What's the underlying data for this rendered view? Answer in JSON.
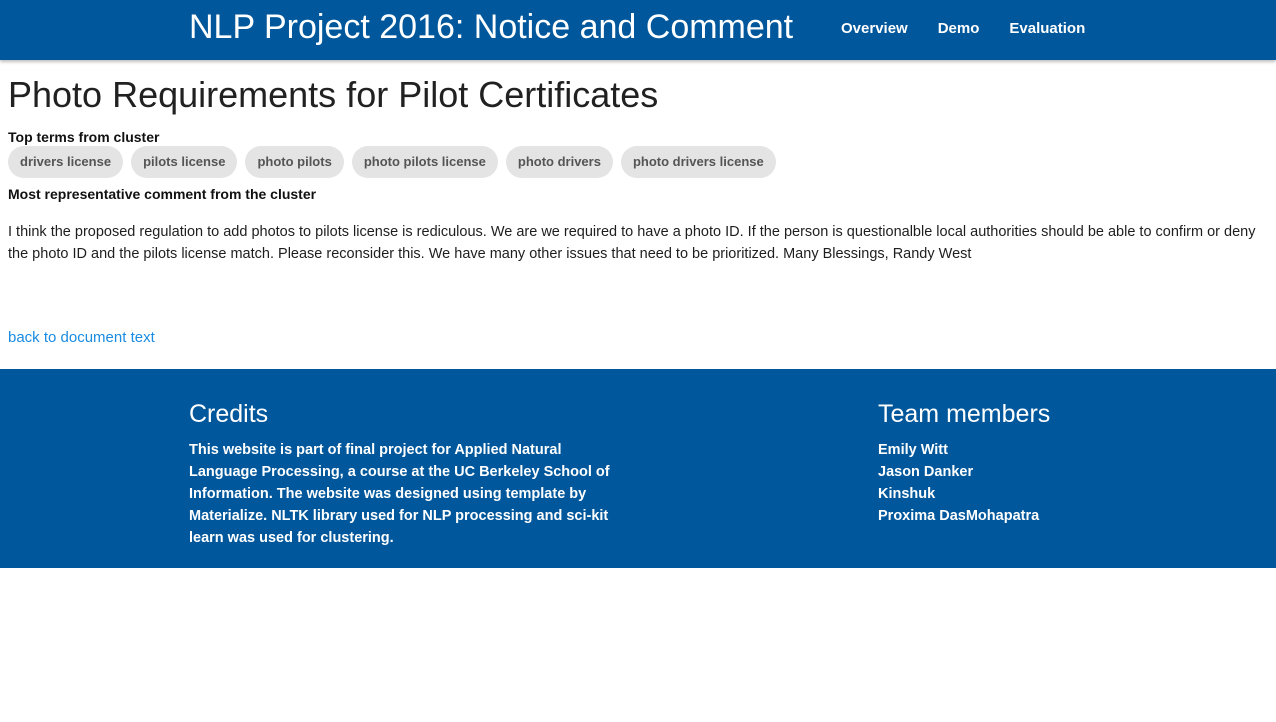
{
  "header": {
    "brand": "NLP Project 2016: Notice and Comment",
    "nav": [
      {
        "label": "Overview"
      },
      {
        "label": "Demo"
      },
      {
        "label": "Evaluation"
      }
    ]
  },
  "main": {
    "title": "Photo Requirements for Pilot Certificates",
    "top_terms_label": "Top terms from cluster",
    "terms": [
      "drivers license",
      "pilots license",
      "photo pilots",
      "photo pilots license",
      "photo drivers",
      "photo drivers license"
    ],
    "representative_label": "Most representative comment from the cluster",
    "comment": "I think the proposed regulation to add photos to pilots license is rediculous. We are we required to have a photo ID. If the person is questionalble local authorities should be able to confirm or deny the photo ID and the pilots license match. Please reconsider this. We have many other issues that need to be prioritized. Many Blessings, Randy West",
    "back_link": "back to document text"
  },
  "footer": {
    "credits_heading": "Credits",
    "credits_text": "This website is part of final project for Applied Natural Language Processing, a course at the UC Berkeley School of Information. The website was designed using template by Materialize. NLTK library used for NLP processing and sci-kit learn was used for clustering.",
    "team_heading": "Team members",
    "team": [
      "Emily Witt",
      "Jason Danker",
      "Kinshuk",
      "Proxima DasMohapatra"
    ]
  },
  "colors": {
    "primary": "#01579b",
    "chip_bg": "#e4e4e4",
    "link": "#1a8be0"
  }
}
